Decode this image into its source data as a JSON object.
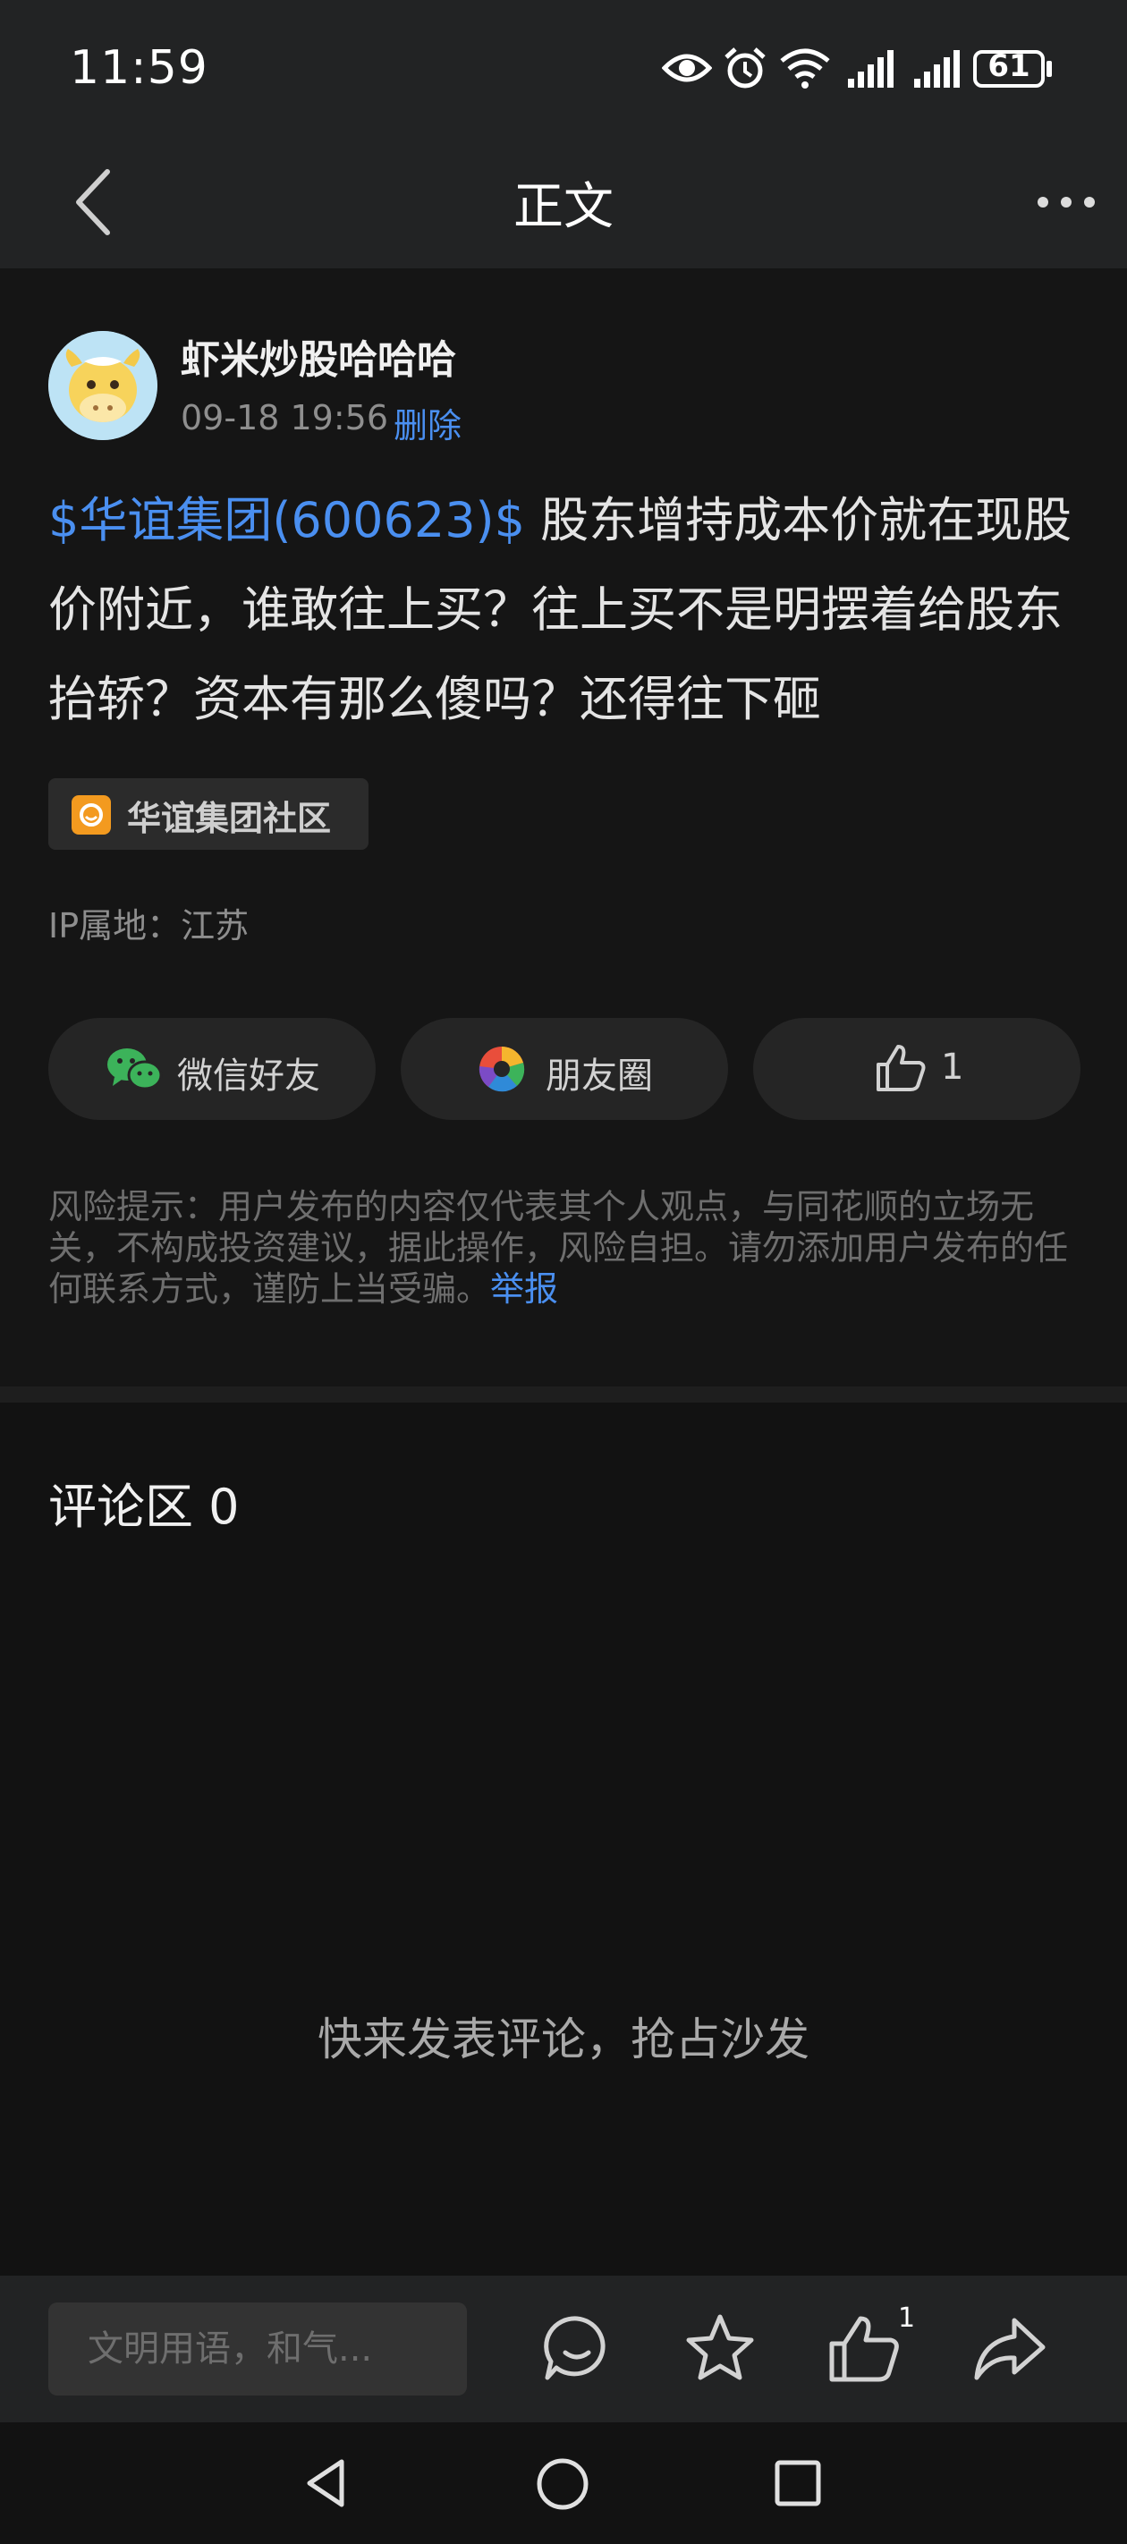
{
  "status_bar": {
    "time": "11:59",
    "battery": "61",
    "icons": [
      "eye-icon",
      "alarm-icon",
      "wifi-icon",
      "signal-icon",
      "signal-icon",
      "battery-icon"
    ]
  },
  "nav": {
    "title": "正文",
    "back_icon": "back-chevron-icon",
    "more_icon": "more-dots-icon"
  },
  "post": {
    "author": "虾米炒股哈哈哈",
    "timestamp": "09-18 19:56",
    "delete_label": "删除",
    "stock_tag": "$华谊集团(600623)$",
    "body": " 股东增持成本价就在现股价附近，谁敢往上买？往上买不是明摆着给股东抬轿？资本有那么傻吗？还得往下砸",
    "community": "华谊集团社区",
    "ip_location": "IP属地：江苏"
  },
  "share": {
    "wechat_label": "微信好友",
    "moments_label": "朋友圈",
    "like_count": "1"
  },
  "risk": {
    "text": "风险提示：用户发布的内容仅代表其个人观点，与同花顺的立场无关，不构成投资建议，据此操作，风险自担。请勿添加用户发布的任何联系方式，谨防上当受骗。",
    "report_label": "举报"
  },
  "comments": {
    "title": "评论区 0",
    "empty_text": "快来发表评论，抢占沙发"
  },
  "toolbar": {
    "input_placeholder": "文明用语，和气...",
    "like_badge": "1"
  },
  "colors": {
    "background": "#121212",
    "accent_blue": "#4a8ff0",
    "bar": "#222324"
  }
}
